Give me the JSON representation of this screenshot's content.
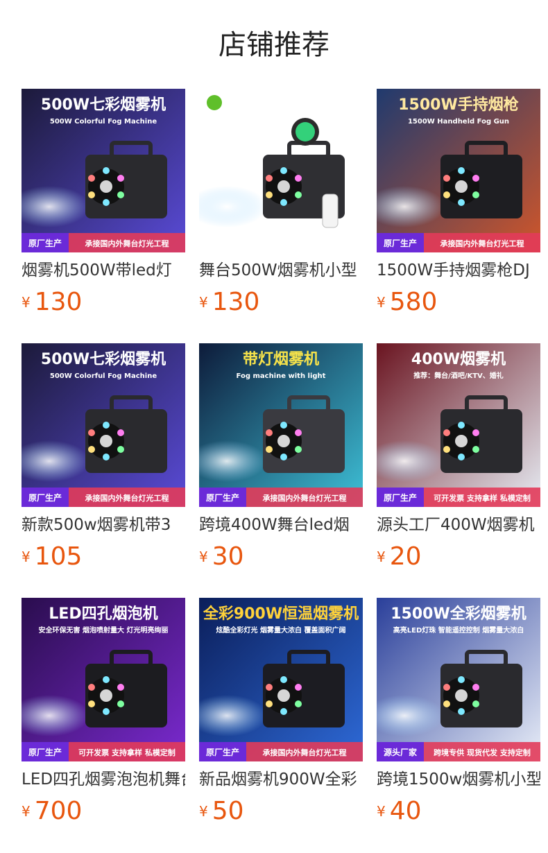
{
  "page": {
    "title": "店铺推荐"
  },
  "colors": {
    "accent": "#e8560e",
    "text": "#333333"
  },
  "products": [
    {
      "name": "烟雾机500W带led灯",
      "currency": "¥",
      "price": "130",
      "thumb": {
        "theme": "dark",
        "headline": "500W七彩烟雾机",
        "subline": "500W Colorful Fog Machine",
        "badge": "原厂生产",
        "banner": "承接国内外舞台灯光工程"
      }
    },
    {
      "name": "舞台500W烟雾机小型",
      "currency": "¥",
      "price": "130",
      "thumb": {
        "theme": "white",
        "headline": "",
        "subline": "",
        "badge": "",
        "banner": ""
      }
    },
    {
      "name": "1500W手持烟雾枪DJ",
      "currency": "¥",
      "price": "580",
      "thumb": {
        "theme": "smoke",
        "headline": "1500W手持烟枪",
        "subline": "1500W Handheld Fog Gun",
        "badge": "原厂生产",
        "banner": "承接国内外舞台灯光工程"
      }
    },
    {
      "name": "新款500w烟雾机带3",
      "currency": "¥",
      "price": "105",
      "thumb": {
        "theme": "dark",
        "headline": "500W七彩烟雾机",
        "subline": "500W Colorful Fog Machine",
        "badge": "原厂生产",
        "banner": "承接国内外舞台灯光工程"
      }
    },
    {
      "name": "跨境400W舞台led烟",
      "currency": "¥",
      "price": "30",
      "thumb": {
        "theme": "stage",
        "headline": "带灯烟雾机",
        "subline": "Fog machine with light",
        "badge": "原厂生产",
        "banner": "承接国内外舞台灯光工程"
      }
    },
    {
      "name": "源头工厂400W烟雾机",
      "currency": "¥",
      "price": "20",
      "thumb": {
        "theme": "red",
        "headline": "400W烟雾机",
        "subline": "推荐：舞台/酒吧/KTV、婚礼",
        "badge": "原厂生产",
        "banner": "可开发票 支持拿样 私模定制"
      }
    },
    {
      "name": "LED四孔烟雾泡泡机舞台",
      "currency": "¥",
      "price": "700",
      "thumb": {
        "theme": "purple",
        "headline": "LED四孔烟泡机",
        "subline": "安全环保无害 烟泡喷射量大 灯光明亮绚丽",
        "badge": "原厂生产",
        "banner": "可开发票 支持拿样 私模定制"
      }
    },
    {
      "name": "新品烟雾机900W全彩",
      "currency": "¥",
      "price": "50",
      "thumb": {
        "theme": "blue",
        "headline": "全彩900W恒温烟雾机",
        "subline": "炫酷全彩灯光 烟雾量大浓白 覆盖面积广阔",
        "badge": "原厂生产",
        "banner": "承接国内外舞台灯光工程"
      }
    },
    {
      "name": "跨境1500w烟雾机小型",
      "currency": "¥",
      "price": "40",
      "thumb": {
        "theme": "light",
        "headline": "1500W全彩烟雾机",
        "subline": "高亮LED灯珠 智能遥控控制 烟雾量大浓白",
        "badge": "源头厂家",
        "banner": "跨境专供 现货代发 支持定制"
      }
    }
  ]
}
